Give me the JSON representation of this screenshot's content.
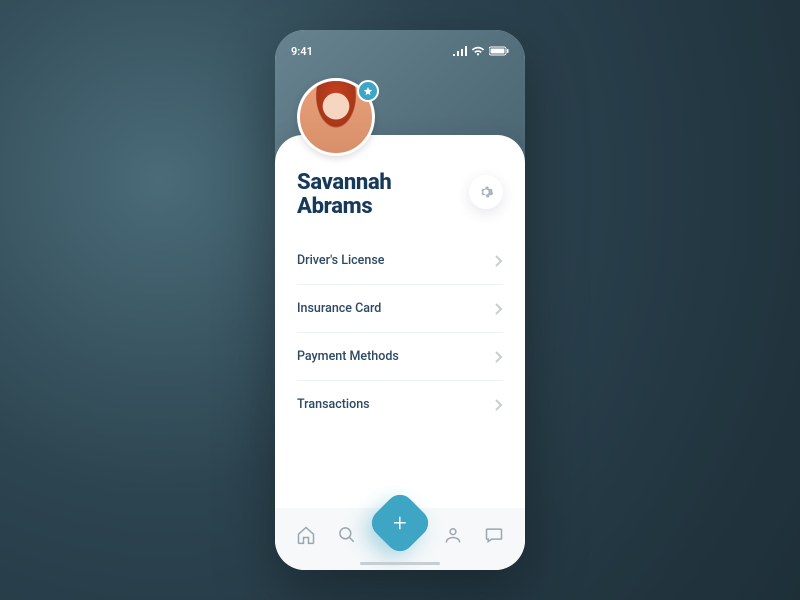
{
  "status": {
    "time": "9:41"
  },
  "profile": {
    "first_name": "Savannah",
    "last_name": "Abrams"
  },
  "menu": {
    "items": [
      {
        "label": "Driver's License"
      },
      {
        "label": "Insurance Card"
      },
      {
        "label": "Payment Methods"
      },
      {
        "label": "Transactions"
      }
    ]
  },
  "colors": {
    "accent": "#3ea5c4",
    "text_primary": "#173a5a"
  }
}
